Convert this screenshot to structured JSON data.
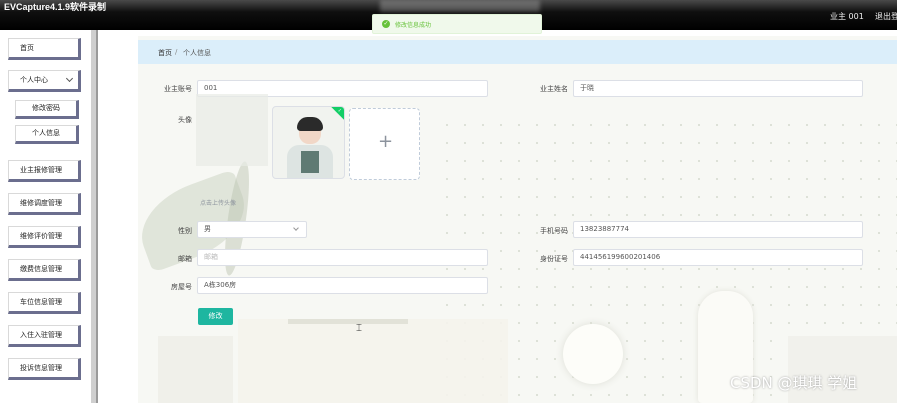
{
  "window": {
    "title": "EVCapture4.1.9软件录制"
  },
  "header": {
    "user_label": "业主 001",
    "logout_label": "退出登录"
  },
  "toast": {
    "message": "修改信息成功"
  },
  "sidebar": {
    "items": [
      {
        "label": "首页"
      },
      {
        "label": "个人中心",
        "expanded": true,
        "children": [
          "修改密码",
          "个人信息"
        ]
      },
      {
        "label": "业主报修管理"
      },
      {
        "label": "维修调度管理"
      },
      {
        "label": "维修评价管理"
      },
      {
        "label": "缴费信息管理"
      },
      {
        "label": "车位信息管理"
      },
      {
        "label": "入住入驻管理"
      },
      {
        "label": "投诉信息管理"
      }
    ]
  },
  "breadcrumb": {
    "home": "首页",
    "separator": "/",
    "current": "个人信息"
  },
  "form": {
    "owner_account": {
      "label": "业主账号",
      "value": "001"
    },
    "owner_name": {
      "label": "业主姓名",
      "value": "于晓"
    },
    "avatar": {
      "label": "头像",
      "upload_hint": "点击上传头像"
    },
    "gender": {
      "label": "性别",
      "value": "男"
    },
    "phone": {
      "label": "手机号码",
      "value": "13823887774"
    },
    "email": {
      "label": "邮箱",
      "placeholder": "邮箱"
    },
    "id_card": {
      "label": "身份证号",
      "value": "441456199600201406"
    },
    "house_no": {
      "label": "房屋号",
      "value": "A栋306房"
    },
    "submit_label": "修改"
  },
  "watermark": "CSDN @琪琪 学姐",
  "colors": {
    "primary_button": "#1eb6a0",
    "breadcrumb_bg": "#dbeefa",
    "success": "#67c23a",
    "sidebar_accent": "#6b6e8e"
  }
}
